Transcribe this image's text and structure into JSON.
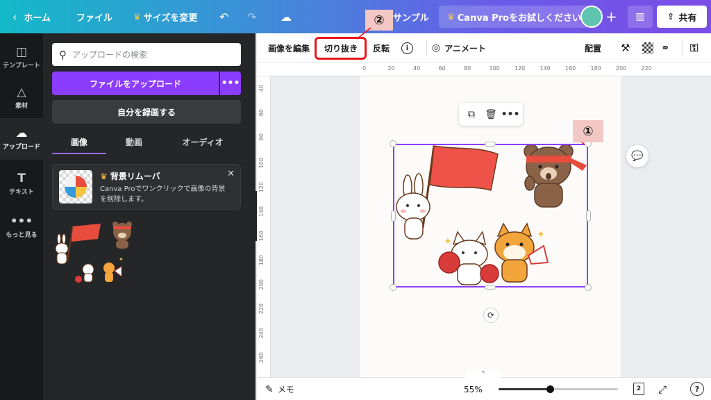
{
  "topbar": {
    "back_label": "ホーム",
    "file_label": "ファイル",
    "resize_label": "サイズを変更",
    "title_label": "サンプル",
    "pro_label": "Canva Proをお試しください",
    "avatar_color": "#5fc4b0",
    "share_label": "共有"
  },
  "rail": {
    "items": [
      {
        "label": "テンプレート",
        "icon": "template-icon"
      },
      {
        "label": "素材",
        "icon": "elements-icon"
      },
      {
        "label": "アップロード",
        "icon": "upload-icon"
      },
      {
        "label": "テキスト",
        "icon": "text-icon"
      },
      {
        "label": "もっと見る",
        "icon": "more-icon"
      }
    ]
  },
  "panel": {
    "search_placeholder": "アップロードの検索",
    "upload_label": "ファイルをアップロード",
    "more_label": "•••",
    "record_label": "自分を録画する",
    "tabs": [
      "画像",
      "動画",
      "オーディオ"
    ],
    "active_tab": "画像",
    "promo": {
      "title": "背景リムーバ",
      "desc": "Canva Proでワンクリックで画像の背景を削除します。"
    }
  },
  "toolbar": {
    "edit_image": "画像を編集",
    "crop": "切り抜き",
    "flip": "反転",
    "info": "i",
    "animate": "アニメート",
    "arrange": "配置"
  },
  "ruler": {
    "h_ticks": [
      "0",
      "20",
      "40",
      "60",
      "80",
      "100",
      "120",
      "140",
      "160",
      "180",
      "200",
      "220"
    ],
    "v_ticks": [
      "40",
      "60",
      "80",
      "100",
      "120",
      "140",
      "160",
      "180",
      "200",
      "220",
      "240",
      "260"
    ]
  },
  "callouts": {
    "one": "①",
    "two": "②"
  },
  "bottom": {
    "notes_label": "メモ",
    "zoom_label": "55%",
    "zoom_value": 0.55,
    "pages": "2",
    "help": "?"
  },
  "colors": {
    "accent": "#8b3dff",
    "highlight": "#e8141c",
    "callout_bg": "#f2c7c4"
  }
}
